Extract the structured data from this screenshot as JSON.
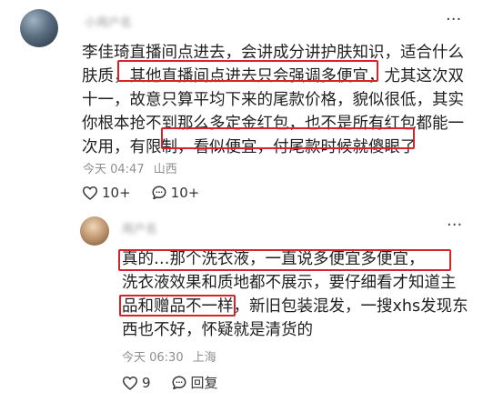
{
  "comment1": {
    "text_lines": [
      "李佳琦直播间点进去，会讲成分讲护肤知识，适合什么",
      "肤质，其他直播间点进去只会强调多便宜，尤其这次双",
      "十一，故意只算平均下来的尾款价格，貌似很低，其实",
      "你根本抢不到那么多定金红包，也不是所有红包都能一",
      "次用，有限制，看似便宜，付尾款时候就傻眼了"
    ],
    "time": "今天 04:47",
    "location": "山西",
    "like_count": "10+",
    "reply_count": "10+"
  },
  "comment2": {
    "text_lines": [
      "真的…那个洗衣液，一直说多便宜多便宜，",
      "洗衣液效果和质地都不展示，要仔细看才知道主",
      "品和赠品不一样，新旧包装混发，一搜xhs发现东",
      "西也不好，怀疑就是清货的"
    ],
    "time": "今天 06:30",
    "location": "上海",
    "like_count": "9",
    "reply_label": "回复"
  },
  "colors": {
    "highlight": "#d8232a",
    "meta": "#8f8f8f",
    "text": "#1f1f1f"
  }
}
